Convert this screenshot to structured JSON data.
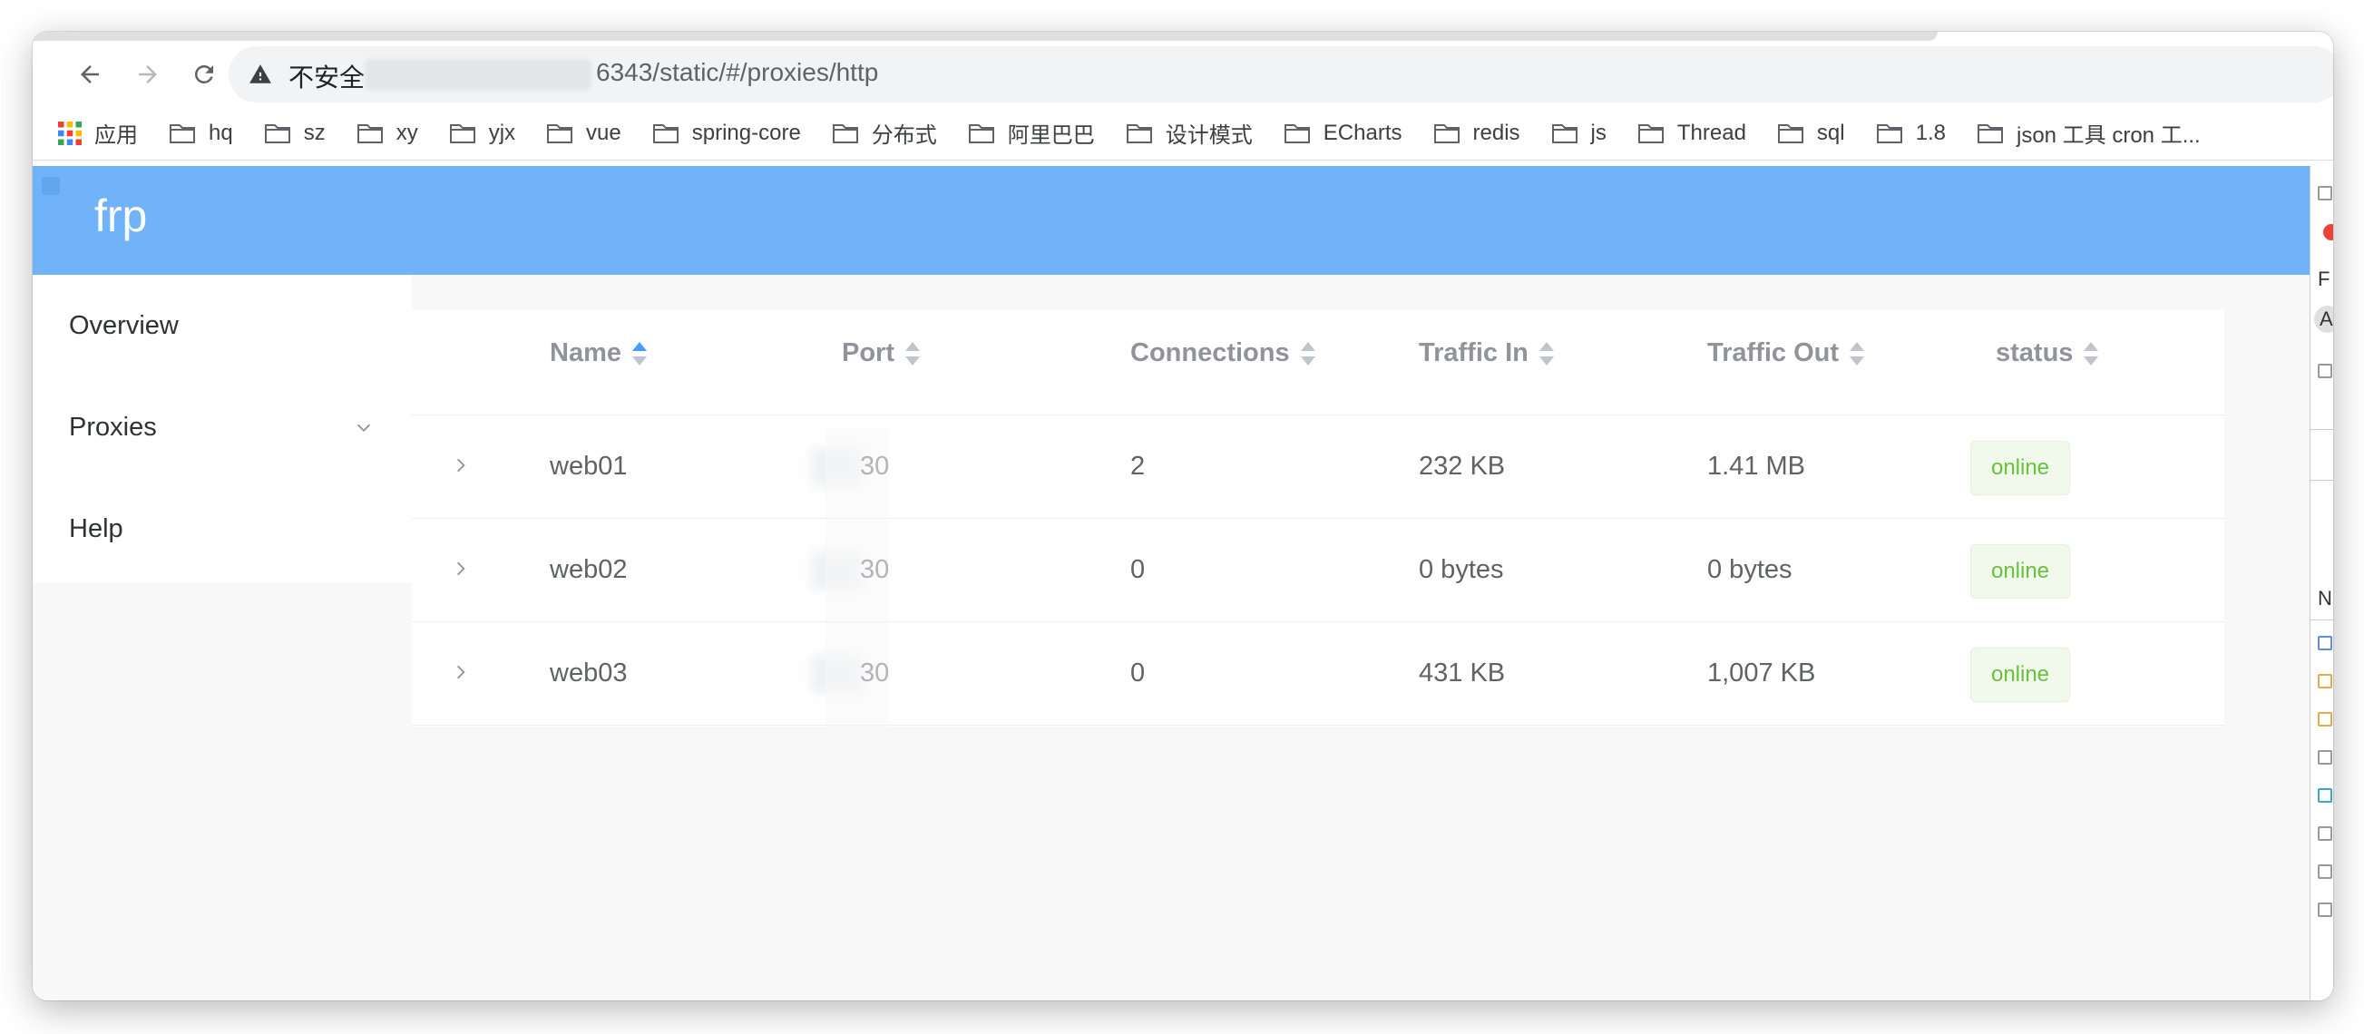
{
  "browser": {
    "insecure_label": "不安全",
    "url_visible": "6343/static/#/proxies/http",
    "bookmarks": [
      {
        "label": "应用",
        "icon": "apps-grid-icon"
      },
      {
        "label": "hq",
        "icon": "folder-icon"
      },
      {
        "label": "sz",
        "icon": "folder-icon"
      },
      {
        "label": "xy",
        "icon": "folder-icon"
      },
      {
        "label": "yjx",
        "icon": "folder-icon"
      },
      {
        "label": "vue",
        "icon": "folder-icon"
      },
      {
        "label": "spring-core",
        "icon": "folder-icon"
      },
      {
        "label": "分布式",
        "icon": "folder-icon"
      },
      {
        "label": "阿里巴巴",
        "icon": "folder-icon"
      },
      {
        "label": "设计模式",
        "icon": "folder-icon"
      },
      {
        "label": "ECharts",
        "icon": "folder-icon"
      },
      {
        "label": "redis",
        "icon": "folder-icon"
      },
      {
        "label": "js",
        "icon": "folder-icon"
      },
      {
        "label": "Thread",
        "icon": "folder-icon"
      },
      {
        "label": "sql",
        "icon": "folder-icon"
      },
      {
        "label": "1.8",
        "icon": "folder-icon"
      },
      {
        "label": "json 工具 cron 工...",
        "icon": "folder-icon"
      }
    ]
  },
  "app": {
    "brand": "frp",
    "colors": {
      "header": "#70b3f8",
      "badge_text": "#67c23a",
      "badge_bg": "#f0f9eb",
      "sort_active": "#409eff"
    },
    "menu": {
      "overview": "Overview",
      "proxies": "Proxies",
      "help": "Help"
    },
    "table": {
      "headers": {
        "name": "Name",
        "port": "Port",
        "connections": "Connections",
        "traffic_in": "Traffic In",
        "traffic_out": "Traffic Out",
        "status": "status"
      },
      "sorted_column": "name",
      "sort_direction": "ascending",
      "rows": [
        {
          "name": "web01",
          "port": "30",
          "connections": "2",
          "traffic_in": "232 KB",
          "traffic_out": "1.41 MB",
          "status": "online"
        },
        {
          "name": "web02",
          "port": "30",
          "connections": "0",
          "traffic_in": "0 bytes",
          "traffic_out": "0 bytes",
          "status": "online"
        },
        {
          "name": "web03",
          "port": "30",
          "connections": "0",
          "traffic_in": "431 KB",
          "traffic_out": "1,007 KB",
          "status": "online"
        }
      ]
    }
  },
  "devtools": {
    "visible_letters": [
      "F",
      "A",
      "N"
    ]
  }
}
